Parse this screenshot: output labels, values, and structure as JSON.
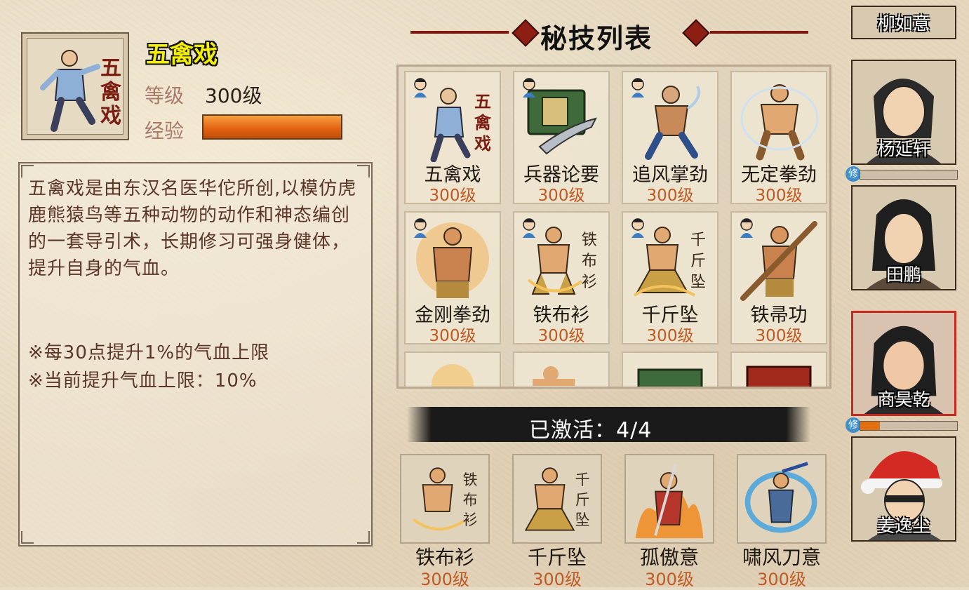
{
  "selected_skill": {
    "name": "五禽戏",
    "level_label": "等级",
    "level_value": "300级",
    "exp_label": "经验",
    "exp_fill": 1.0,
    "description": "五禽戏是由东汉名医华佗所创,以模仿虎鹿熊猿鸟等五种动物的动作和神态编创的一套导引术，长期修习可强身健体，提升自身的气血。",
    "notes": [
      "※每30点提升1%的气血上限",
      "※当前提升气血上限：10%"
    ]
  },
  "skill_list": {
    "title": "秘技列表",
    "cards": [
      {
        "name": "五禽戏",
        "level": "300级",
        "art": "crane-form-fighter-icon"
      },
      {
        "name": "兵器论要",
        "level": "300级",
        "art": "weapon-book-icon"
      },
      {
        "name": "追风掌劲",
        "level": "300级",
        "art": "palm-strike-fighter-icon"
      },
      {
        "name": "无定拳劲",
        "level": "300级",
        "art": "fist-fighter-icon"
      },
      {
        "name": "金刚拳劲",
        "level": "300级",
        "art": "vajra-fist-fighter-icon"
      },
      {
        "name": "铁布衫",
        "level": "300级",
        "art": "iron-shirt-fighter-icon"
      },
      {
        "name": "千斤坠",
        "level": "300级",
        "art": "thousand-jin-fighter-icon"
      },
      {
        "name": "铁帚功",
        "level": "300级",
        "art": "iron-broom-fighter-icon"
      }
    ]
  },
  "activated": {
    "label": "已激活：4/4",
    "items": [
      {
        "name": "铁布衫",
        "level": "300级",
        "art": "iron-shirt-fighter-icon"
      },
      {
        "name": "千斤坠",
        "level": "300级",
        "art": "thousand-jin-fighter-icon"
      },
      {
        "name": "孤傲意",
        "level": "300级",
        "art": "lone-pride-swordsman-icon"
      },
      {
        "name": "啸风刀意",
        "level": "300级",
        "art": "wind-blade-swordsman-icon"
      }
    ]
  },
  "roster": [
    {
      "name": "柳如意"
    },
    {
      "name": "杨延轩",
      "cultivation_fill": 0.0
    },
    {
      "name": "田鹏"
    },
    {
      "name": "商昊乾",
      "cultivation_fill": 0.2,
      "selected": true
    },
    {
      "name": "姜逸尘"
    }
  ],
  "cultivation_tag": "修",
  "colors": {
    "accent_red": "#8c1e14",
    "exp_orange": "#e06010",
    "level_orange": "#c05a22",
    "name_yellow": "#f4f000"
  }
}
